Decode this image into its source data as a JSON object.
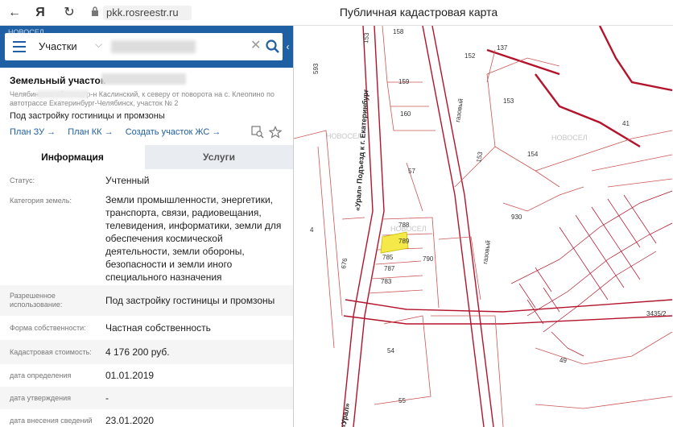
{
  "browser": {
    "back": "←",
    "yandex": "Я",
    "reload": "↻",
    "url": "pkk.rosreestr.ru",
    "title": "Публичная кадастровая карта"
  },
  "search": {
    "type_label": "Участки",
    "watermark": "НОВОСЕЛ"
  },
  "parcel": {
    "title": "Земельный участок",
    "address": "Челябинская область, р-н Каслинский, к северу от поворота на с. Клеопино по автотрассе Екатеринбург-Челябинск, участок № 2",
    "purpose": "Под застройку гостиницы и промзоны",
    "links": [
      "План ЗУ →",
      "План КК →",
      "Создать участок ЖС →"
    ]
  },
  "tabs": {
    "info": "Информация",
    "services": "Услуги"
  },
  "attributes": [
    {
      "key": "Статус:",
      "value": "Учтенный"
    },
    {
      "key": "Категория земель:",
      "value": "Земли промышленности, энергетики, транспорта, связи, радиовещания, телевидения, информатики, земли для обеспечения космической деятельности, земли обороны, безопасности и земли иного специального назначения"
    },
    {
      "key": "Разрешенное использование:",
      "value": "Под застройку гостиницы и промзоны"
    },
    {
      "key": "Форма собственности:",
      "value": "Частная собственность"
    },
    {
      "key": "Кадастровая стоимость:",
      "value": "4 176 200 руб."
    },
    {
      "key": "дата определения",
      "value": "01.01.2019"
    },
    {
      "key": "дата утверждения",
      "value": "-"
    },
    {
      "key": "дата внесения сведений",
      "value": "23.01.2020"
    }
  ],
  "map": {
    "road_name": "«Урал» Подъезд к г. Екатеринбург",
    "road_name_short": "«Урал»",
    "gas_label": "газовый",
    "watermark": "НОВОСЕЛ",
    "parcels": [
      "158",
      "159",
      "160",
      "57",
      "788",
      "789",
      "785",
      "787",
      "783",
      "790",
      "4",
      "676",
      "54",
      "55",
      "152",
      "153",
      "154",
      "930",
      "137",
      "41",
      "49",
      "3435/2",
      "593",
      "153"
    ],
    "selected_color": "#f5e94a",
    "boundary_color": "#b3132b"
  }
}
